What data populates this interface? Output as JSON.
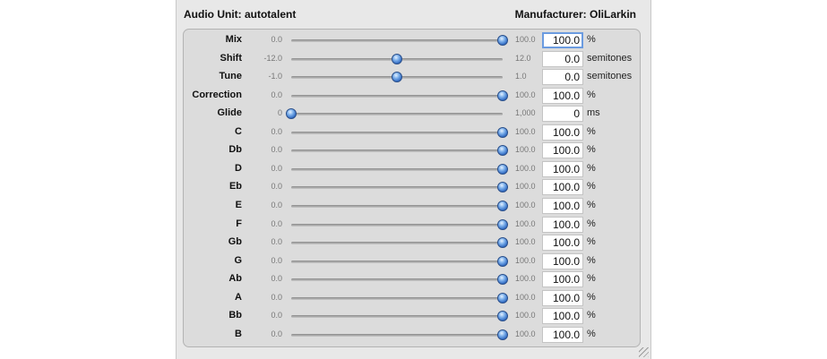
{
  "header": {
    "audio_unit": "Audio Unit: autotalent",
    "manufacturer": "Manufacturer: OliLarkin"
  },
  "params": [
    {
      "name": "Mix",
      "min": "0.0",
      "max": "100.0",
      "value": "100.0",
      "unit": "%",
      "fraction": 1.0
    },
    {
      "name": "Shift",
      "min": "-12.0",
      "max": "12.0",
      "value": "0.0",
      "unit": "semitones",
      "fraction": 0.5
    },
    {
      "name": "Tune",
      "min": "-1.0",
      "max": "1.0",
      "value": "0.0",
      "unit": "semitones",
      "fraction": 0.5
    },
    {
      "name": "Correction",
      "min": "0.0",
      "max": "100.0",
      "value": "100.0",
      "unit": "%",
      "fraction": 1.0
    },
    {
      "name": "Glide",
      "min": "0",
      "max": "1,000",
      "value": "0",
      "unit": "ms",
      "fraction": 0.0
    },
    {
      "name": "C",
      "min": "0.0",
      "max": "100.0",
      "value": "100.0",
      "unit": "%",
      "fraction": 1.0
    },
    {
      "name": "Db",
      "min": "0.0",
      "max": "100.0",
      "value": "100.0",
      "unit": "%",
      "fraction": 1.0
    },
    {
      "name": "D",
      "min": "0.0",
      "max": "100.0",
      "value": "100.0",
      "unit": "%",
      "fraction": 1.0
    },
    {
      "name": "Eb",
      "min": "0.0",
      "max": "100.0",
      "value": "100.0",
      "unit": "%",
      "fraction": 1.0
    },
    {
      "name": "E",
      "min": "0.0",
      "max": "100.0",
      "value": "100.0",
      "unit": "%",
      "fraction": 1.0
    },
    {
      "name": "F",
      "min": "0.0",
      "max": "100.0",
      "value": "100.0",
      "unit": "%",
      "fraction": 1.0
    },
    {
      "name": "Gb",
      "min": "0.0",
      "max": "100.0",
      "value": "100.0",
      "unit": "%",
      "fraction": 1.0
    },
    {
      "name": "G",
      "min": "0.0",
      "max": "100.0",
      "value": "100.0",
      "unit": "%",
      "fraction": 1.0
    },
    {
      "name": "Ab",
      "min": "0.0",
      "max": "100.0",
      "value": "100.0",
      "unit": "%",
      "fraction": 1.0
    },
    {
      "name": "A",
      "min": "0.0",
      "max": "100.0",
      "value": "100.0",
      "unit": "%",
      "fraction": 1.0
    },
    {
      "name": "Bb",
      "min": "0.0",
      "max": "100.0",
      "value": "100.0",
      "unit": "%",
      "fraction": 1.0
    },
    {
      "name": "B",
      "min": "0.0",
      "max": "100.0",
      "value": "100.0",
      "unit": "%",
      "fraction": 1.0
    }
  ]
}
